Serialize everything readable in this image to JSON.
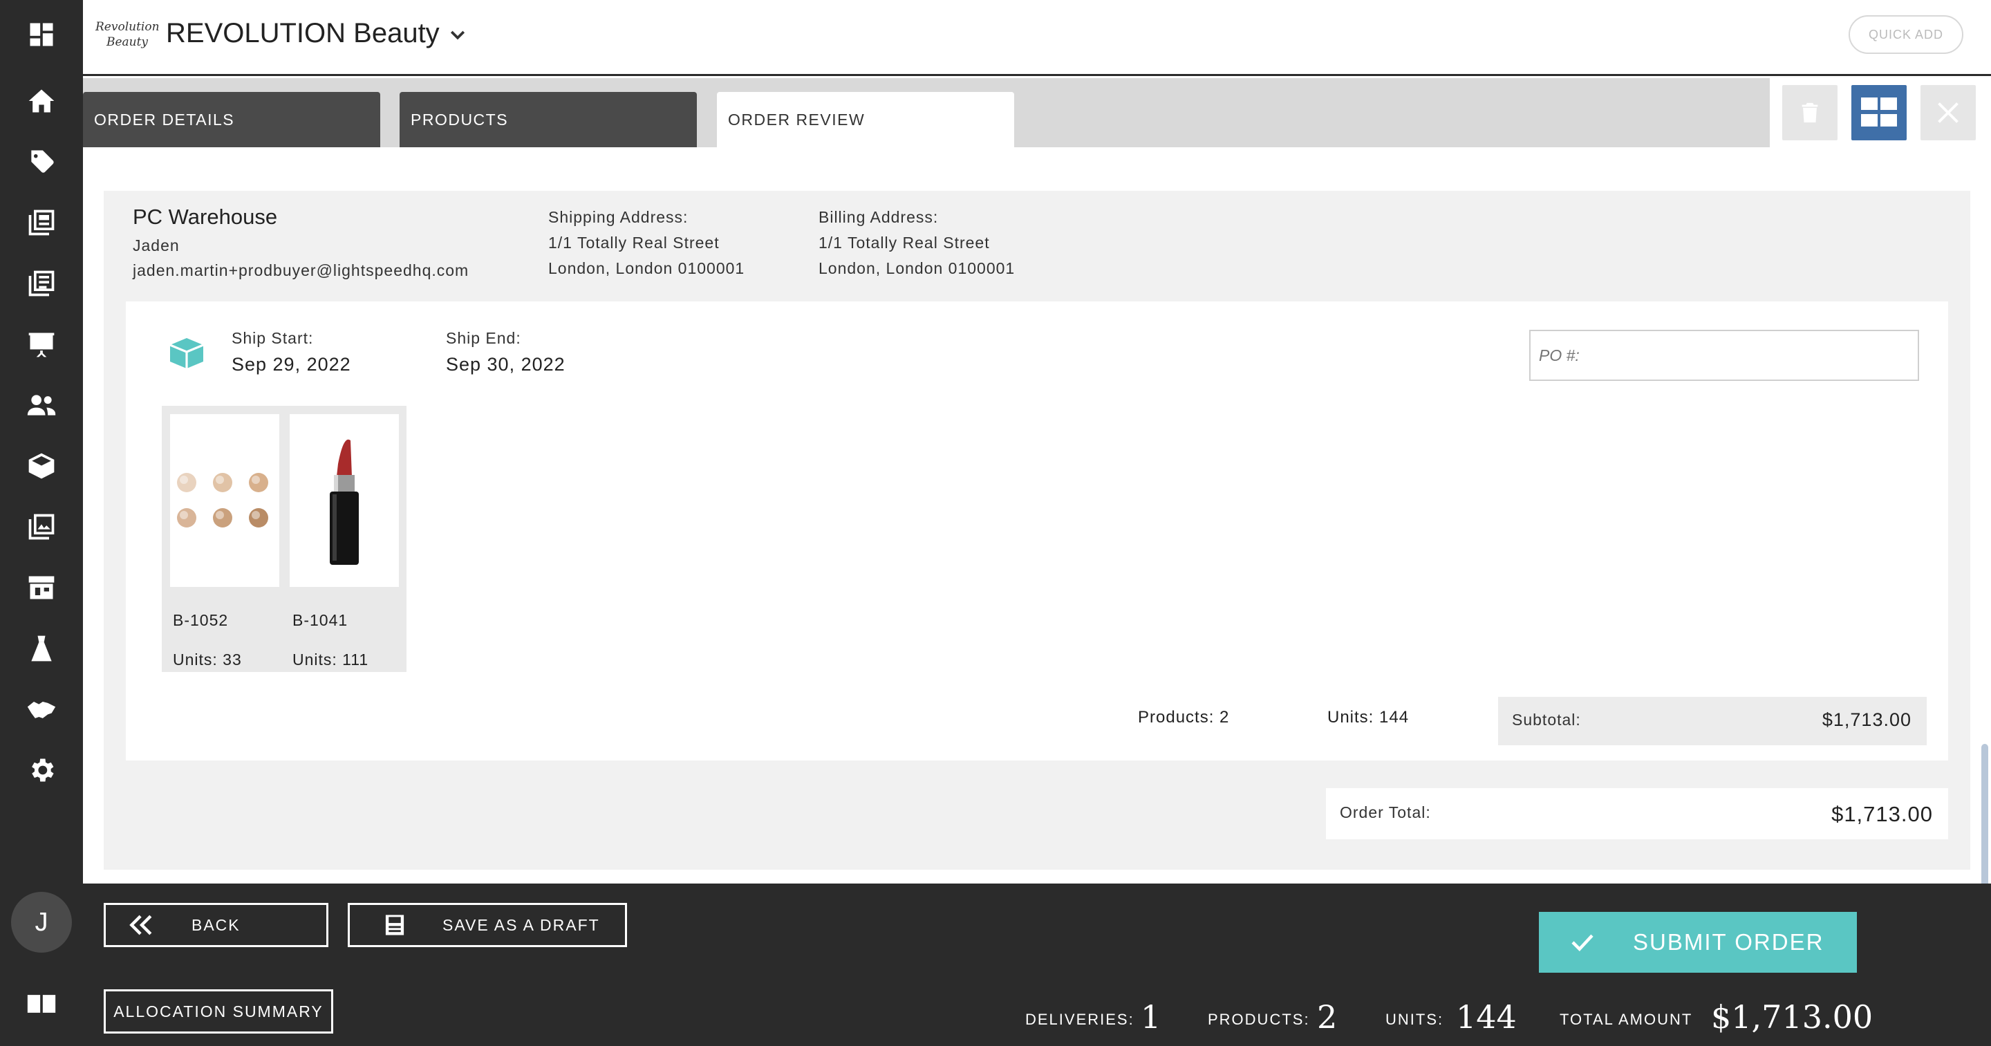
{
  "sidebar": {
    "items": [
      "dashboard-icon",
      "home-icon",
      "tag-icon",
      "catalog-icon",
      "orders-list-icon",
      "presentation-icon",
      "users-icon",
      "box-icon",
      "images-icon",
      "store-icon",
      "fashion-icon",
      "handshake-icon",
      "gear-icon"
    ],
    "avatar_initial": "J",
    "bottom_icon": "book-icon"
  },
  "header": {
    "logo_text": "Revolution Beauty",
    "title": "REVOLUTION Beauty",
    "quick_add": "QUICK ADD"
  },
  "tabs": [
    {
      "label": "ORDER DETAILS",
      "active": false
    },
    {
      "label": "PRODUCTS",
      "active": false
    },
    {
      "label": "ORDER REVIEW",
      "active": true
    }
  ],
  "customer": {
    "name": "PC Warehouse",
    "contact": "Jaden",
    "email": "jaden.martin+prodbuyer@lightspeedhq.com"
  },
  "shipping": {
    "label": "Shipping Address:",
    "line1": "1/1 Totally Real Street",
    "line2": "London, London 0100001"
  },
  "billing": {
    "label": "Billing Address:",
    "line1": "1/1 Totally Real Street",
    "line2": "London, London 0100001"
  },
  "delivery": {
    "ship_start_label": "Ship Start:",
    "ship_start": "Sep 29, 2022",
    "ship_end_label": "Ship End:",
    "ship_end": "Sep 30, 2022",
    "po_placeholder": "PO #:",
    "products": [
      {
        "sku": "B-1052",
        "units": "Units: 33"
      },
      {
        "sku": "B-1041",
        "units": "Units: 111"
      }
    ],
    "products_count": "Products: 2",
    "units_count": "Units: 144",
    "subtotal_label": "Subtotal:",
    "subtotal": "$1,713.00"
  },
  "order_total": {
    "label": "Order Total:",
    "value": "$1,713.00"
  },
  "footer": {
    "back": "BACK",
    "save_draft": "SAVE AS A DRAFT",
    "allocation": "ALLOCATION SUMMARY",
    "submit": "SUBMIT ORDER",
    "deliveries_label": "DELIVERIES:",
    "deliveries": "1",
    "products_label": "PRODUCTS:",
    "products": "2",
    "units_label": "UNITS:",
    "units": "144",
    "total_label": "TOTAL AMOUNT",
    "total": "$1,713.00"
  },
  "colors": {
    "sidebar": "#2b2b2b",
    "accent": "#5ac6c3",
    "active_tool": "#3f6fa8"
  }
}
